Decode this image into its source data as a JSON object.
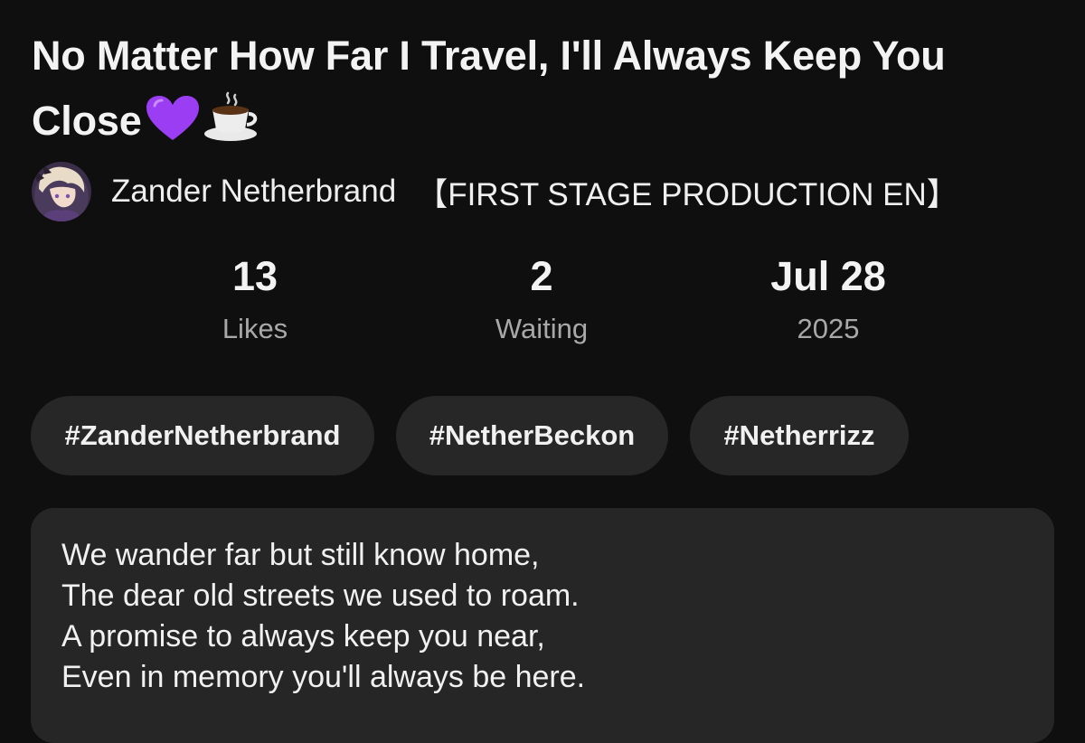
{
  "video": {
    "title": "No Matter How Far I Travel, I'll Always Keep You Close",
    "title_emojis": [
      "purple-heart-icon",
      "hot-beverage-icon"
    ]
  },
  "channel": {
    "name": "Zander Netherbrand",
    "tag": "【FIRST STAGE PRODUCTION EN】"
  },
  "stats": [
    {
      "value": "13",
      "label": "Likes"
    },
    {
      "value": "2",
      "label": "Waiting"
    },
    {
      "value": "Jul 28",
      "label": "2025"
    }
  ],
  "hashtags": [
    "#ZanderNetherbrand",
    "#NetherBeckon",
    "#Netherrizz"
  ],
  "description": {
    "lines": [
      "We wander far but still know home,",
      "The dear old streets we used to roam.",
      "A promise to always keep you near,",
      "Even in memory you'll always be here."
    ]
  },
  "colors": {
    "background": "#0f0f0f",
    "chip": "#272727",
    "card": "#262626",
    "muted_text": "#a8a8a8",
    "heart": "#9b3df2"
  }
}
